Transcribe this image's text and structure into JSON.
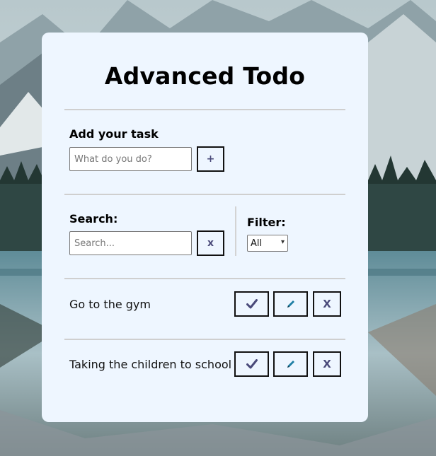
{
  "app": {
    "title": "Advanced Todo"
  },
  "add_section": {
    "label": "Add your task",
    "input_placeholder": "What do you do?",
    "add_button_label": "+"
  },
  "search_section": {
    "label": "Search:",
    "input_placeholder": "Search...",
    "clear_button_label": "x"
  },
  "filter_section": {
    "label": "Filter:",
    "selected": "All"
  },
  "tasks": [
    {
      "text": "Go to the gym"
    },
    {
      "text": "Taking the children to school"
    }
  ],
  "task_actions": {
    "remove_label": "X"
  },
  "colors": {
    "card_bg": "#eef6ff",
    "icon_accent": "#4a4a7a"
  }
}
